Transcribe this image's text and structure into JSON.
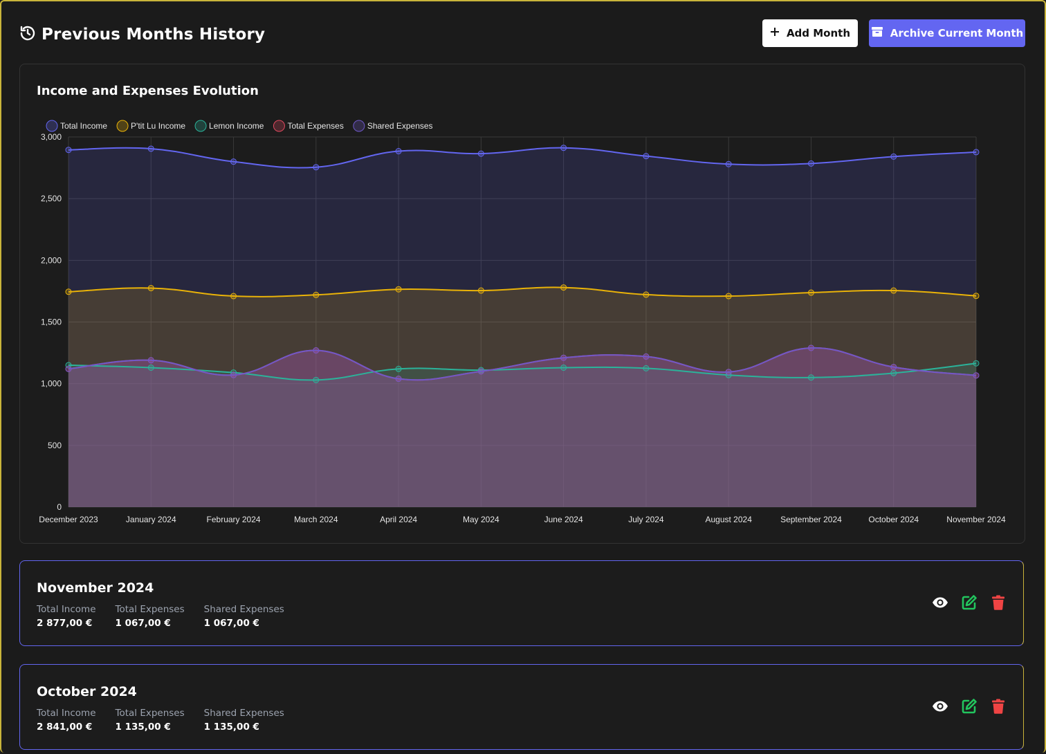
{
  "header": {
    "title": "Previous Months History",
    "add_label": "Add Month",
    "archive_label": "Archive Current Month"
  },
  "colors": {
    "accent": "#6366f1",
    "border_gold": "#c9b43a",
    "total_income": "#6366f1",
    "ptit_lu_income": "#eab308",
    "lemon_income": "#2bb39a",
    "total_expenses": "#e0495f",
    "shared_expenses": "#6f58c9",
    "view_icon": "#ffffff",
    "edit_icon": "#22c55e",
    "delete_icon": "#ef4444"
  },
  "chart": {
    "title": "Income and Expenses Evolution"
  },
  "chart_data": {
    "type": "area",
    "title": "Income and Expenses Evolution",
    "categories": [
      "December 2023",
      "January 2024",
      "February 2024",
      "March 2024",
      "April 2024",
      "May 2024",
      "June 2024",
      "July 2024",
      "August 2024",
      "September 2024",
      "October 2024",
      "November 2024"
    ],
    "ylim": [
      0,
      3000
    ],
    "yticks": [
      0,
      500,
      1000,
      1500,
      2000,
      2500,
      3000
    ],
    "ytick_labels": [
      "0",
      "500",
      "1,000",
      "1,500",
      "2,000",
      "2,500",
      "3,000"
    ],
    "grid": true,
    "legend_position": "top-left",
    "series": [
      {
        "name": "Total Income",
        "color": "#6366f1",
        "values": [
          2895,
          2905,
          2800,
          2755,
          2885,
          2865,
          2912,
          2845,
          2780,
          2785,
          2841,
          2877
        ]
      },
      {
        "name": "P'tit Lu Income",
        "color": "#eab308",
        "values": [
          1745,
          1775,
          1710,
          1720,
          1765,
          1755,
          1780,
          1722,
          1710,
          1738,
          1755,
          1712
        ]
      },
      {
        "name": "Lemon Income",
        "color": "#2bb39a",
        "values": [
          1150,
          1130,
          1090,
          1030,
          1120,
          1110,
          1130,
          1125,
          1070,
          1050,
          1086,
          1165
        ]
      },
      {
        "name": "Total Expenses",
        "color": "#e0495f",
        "values": [
          1120,
          1190,
          1070,
          1270,
          1040,
          1100,
          1210,
          1220,
          1095,
          1290,
          1135,
          1067
        ]
      },
      {
        "name": "Shared Expenses",
        "color": "#6f58c9",
        "values": [
          1120,
          1190,
          1070,
          1270,
          1040,
          1100,
          1210,
          1220,
          1095,
          1290,
          1135,
          1067
        ]
      }
    ]
  },
  "months": [
    {
      "name": "November 2024",
      "stats": [
        {
          "label": "Total Income",
          "value": "2 877,00 €"
        },
        {
          "label": "Total Expenses",
          "value": "1 067,00 €"
        },
        {
          "label": "Shared Expenses",
          "value": "1 067,00 €"
        }
      ],
      "actions": {
        "view": "eye-icon",
        "edit": "edit-icon",
        "delete": "trash-icon"
      }
    },
    {
      "name": "October 2024",
      "stats": [
        {
          "label": "Total Income",
          "value": "2 841,00 €"
        },
        {
          "label": "Total Expenses",
          "value": "1 135,00 €"
        },
        {
          "label": "Shared Expenses",
          "value": "1 135,00 €"
        }
      ],
      "actions": {
        "view": "eye-icon",
        "edit": "edit-icon",
        "delete": "trash-icon"
      }
    }
  ]
}
